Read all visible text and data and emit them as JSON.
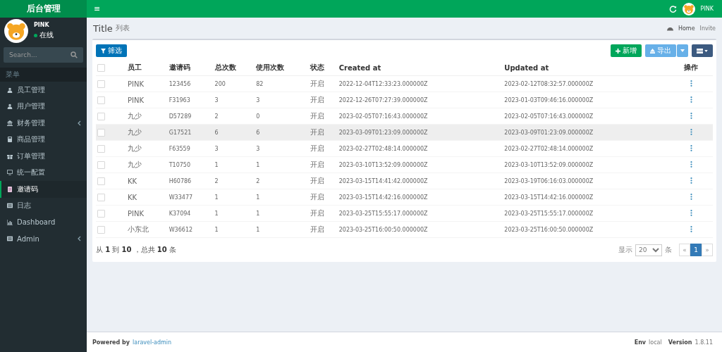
{
  "brand": "后台管理",
  "user": {
    "name": "PINK",
    "status": "在线"
  },
  "sidebar": {
    "search": {
      "placeholder": "Search..."
    },
    "section": "菜单",
    "items": [
      {
        "label": "员工管理",
        "selected": false,
        "has_children": false
      },
      {
        "label": "用户管理",
        "selected": false,
        "has_children": false
      },
      {
        "label": "财务管理",
        "selected": false,
        "has_children": true
      },
      {
        "label": "商品管理",
        "selected": false,
        "has_children": false
      },
      {
        "label": "订单管理",
        "selected": false,
        "has_children": false
      },
      {
        "label": "统一配置",
        "selected": false,
        "has_children": false
      },
      {
        "label": "邀请码",
        "selected": true,
        "has_children": false
      },
      {
        "label": "日志",
        "selected": false,
        "has_children": false
      },
      {
        "label": "Dashboard",
        "selected": false,
        "has_children": false
      },
      {
        "label": "Admin",
        "selected": false,
        "has_children": true
      }
    ]
  },
  "topbar": {
    "menu_glyph": "≡",
    "user": "PINK"
  },
  "page": {
    "title": "Title",
    "subtitle": "列表",
    "breadcrumb": [
      "Home",
      "Invite"
    ]
  },
  "toolbar": {
    "filter": "筛选",
    "create": "新增",
    "export": "导出"
  },
  "table": {
    "select_all_checked": false,
    "columns": [
      "员工",
      "邀请码",
      "总次数",
      "使用次数",
      "状态",
      "Created at",
      "Updated at",
      "操作"
    ],
    "rows": [
      {
        "highlighted": false,
        "cells": [
          "PINK",
          "123456",
          "200",
          "82",
          "开启",
          "2022-12-04T12:33:23.000000Z",
          "2023-02-12T08:32:57.000000Z"
        ]
      },
      {
        "highlighted": false,
        "cells": [
          "PINK",
          "F31963",
          "3",
          "3",
          "开启",
          "2022-12-26T07:27:39.000000Z",
          "2023-01-03T09:46:16.000000Z"
        ]
      },
      {
        "highlighted": false,
        "cells": [
          "九少",
          "D57289",
          "2",
          "0",
          "开启",
          "2023-02-05T07:16:43.000000Z",
          "2023-02-05T07:16:43.000000Z"
        ]
      },
      {
        "highlighted": true,
        "cells": [
          "九少",
          "G17521",
          "6",
          "6",
          "开启",
          "2023-03-09T01:23:09.000000Z",
          "2023-03-09T01:23:09.000000Z"
        ]
      },
      {
        "highlighted": false,
        "cells": [
          "九少",
          "F63559",
          "3",
          "3",
          "开启",
          "2023-02-27T02:48:14.000000Z",
          "2023-02-27T02:48:14.000000Z"
        ]
      },
      {
        "highlighted": false,
        "cells": [
          "九少",
          "T10750",
          "1",
          "1",
          "开启",
          "2023-03-10T13:52:09.000000Z",
          "2023-03-10T13:52:09.000000Z"
        ]
      },
      {
        "highlighted": false,
        "cells": [
          "KK",
          "H60786",
          "2",
          "2",
          "开启",
          "2023-03-15T14:41:42.000000Z",
          "2023-03-19T06:16:03.000000Z"
        ]
      },
      {
        "highlighted": false,
        "cells": [
          "KK",
          "W33477",
          "1",
          "1",
          "开启",
          "2023-03-15T14:42:16.000000Z",
          "2023-03-15T14:42:16.000000Z"
        ]
      },
      {
        "highlighted": false,
        "cells": [
          "PINK",
          "K37094",
          "1",
          "1",
          "开启",
          "2023-03-25T15:55:17.000000Z",
          "2023-03-25T15:55:17.000000Z"
        ]
      },
      {
        "highlighted": false,
        "cells": [
          "小东北",
          "W36612",
          "1",
          "1",
          "开启",
          "2023-03-25T16:00:50.000000Z",
          "2023-03-25T16:00:50.000000Z"
        ]
      }
    ]
  },
  "summary": "从 **1** 到 **10** ，总共 **10** 条",
  "pagination": {
    "show_label": "显示",
    "per_page": "20",
    "unit": "条",
    "prev": "«",
    "next": "»",
    "pages": [
      {
        "label": "1",
        "selected": true
      }
    ]
  },
  "footer": {
    "powered": "Powered by",
    "link": "laravel-admin",
    "env_label": "Env",
    "env": "local",
    "version_label": "Version",
    "version": "1.8.11"
  }
}
